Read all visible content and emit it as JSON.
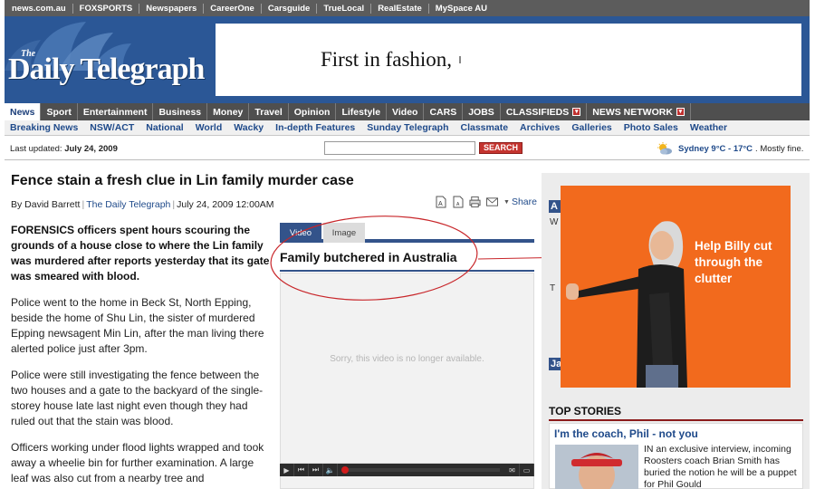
{
  "network_bar": [
    "news.com.au",
    "FOXSPORTS",
    "Newspapers",
    "CareerOne",
    "Carsguide",
    "TrueLocal",
    "RealEstate",
    "MySpace AU"
  ],
  "masthead": {
    "logo_the": "The",
    "logo_name": "Daily Telegraph",
    "banner_text": "First in fashion,"
  },
  "section_nav": [
    {
      "label": "News",
      "active": true,
      "dropdown": false
    },
    {
      "label": "Sport",
      "active": false,
      "dropdown": false
    },
    {
      "label": "Entertainment",
      "active": false,
      "dropdown": false
    },
    {
      "label": "Business",
      "active": false,
      "dropdown": false
    },
    {
      "label": "Money",
      "active": false,
      "dropdown": false
    },
    {
      "label": "Travel",
      "active": false,
      "dropdown": false
    },
    {
      "label": "Opinion",
      "active": false,
      "dropdown": false
    },
    {
      "label": "Lifestyle",
      "active": false,
      "dropdown": false
    },
    {
      "label": "Video",
      "active": false,
      "dropdown": false
    },
    {
      "label": "CARS",
      "active": false,
      "dropdown": false
    },
    {
      "label": "JOBS",
      "active": false,
      "dropdown": false
    },
    {
      "label": "CLASSIFIEDS",
      "active": false,
      "dropdown": true
    },
    {
      "label": "NEWS NETWORK",
      "active": false,
      "dropdown": true
    }
  ],
  "sub_nav": [
    "Breaking News",
    "NSW/ACT",
    "National",
    "World",
    "Wacky",
    "In-depth Features",
    "Sunday Telegraph",
    "Classmate",
    "Archives",
    "Galleries",
    "Photo Sales",
    "Weather"
  ],
  "utility": {
    "updated_label": "Last updated:",
    "updated_date": "July 24, 2009",
    "search_value": "",
    "search_button": "SEARCH",
    "weather_city": "Sydney 9°C - 17°C",
    "weather_desc": ". Mostly fine."
  },
  "article": {
    "headline": "Fence stain a fresh clue in Lin family murder case",
    "author": "By David Barrett",
    "source": "The Daily Telegraph",
    "date": "July 24, 2009 12:00AM",
    "share_label": "Share",
    "paragraphs": [
      "FORENSICS officers spent hours scouring the grounds of a house close to where the Lin family was murdered after reports yesterday that its gate was smeared with blood.",
      "Police went to the home in Beck St, North Epping, beside the home of Shu Lin, the sister of murdered Epping newsagent Min Lin, after the man living there alerted police just after 3pm.",
      "Police were still investigating the fence between the two houses and a gate to the backyard of the single-storey house late last night even though they had ruled out that the stain was blood.",
      "Officers working under flood lights wrapped and took away a wheelie bin for further examination. A large leaf was also cut from a nearby tree and"
    ]
  },
  "media": {
    "tabs": [
      "Video",
      "Image"
    ],
    "title": "Family butchered in Australia",
    "unavailable_msg": "Sorry, this video is no longer available.",
    "progress": 0,
    "annotation_color": "#c8262a"
  },
  "sidebar": {
    "peek_letters": [
      "A",
      "W",
      "T",
      "Ja"
    ],
    "ad_copy": "Help Billy cut through the clutter",
    "top_stories_heading": "TOP STORIES",
    "story": {
      "title": "I'm the coach, Phil - not you",
      "text": "IN an exclusive interview, incoming Roosters coach Brian Smith has buried the notion he will be a puppet for Phil Gould"
    }
  },
  "colors": {
    "brand_blue": "#2b5796",
    "nav_dark": "#4f4f4f",
    "link_blue": "#1f4a8a",
    "search_red": "#c4342f",
    "ad_orange": "#f26a1d"
  }
}
